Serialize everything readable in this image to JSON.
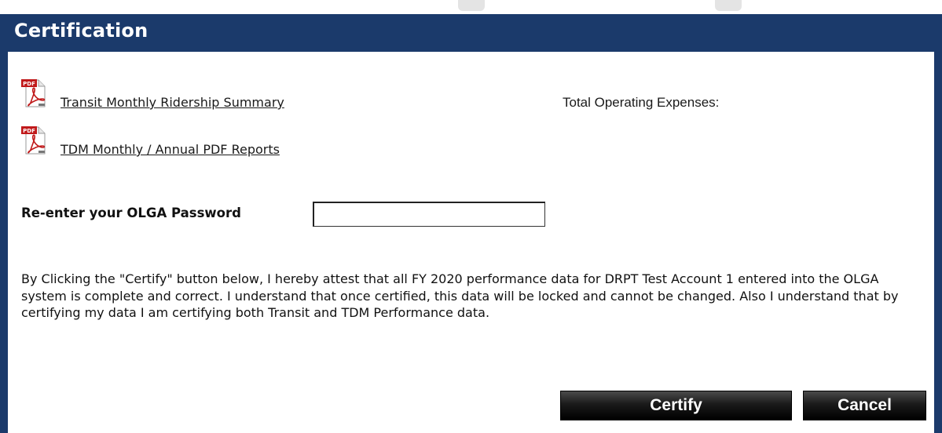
{
  "panel": {
    "title": "Certification",
    "header_color": "#1b3a6b"
  },
  "links": [
    {
      "label": "Transit Monthly Ridership Summary",
      "icon": "pdf-icon"
    },
    {
      "label": "TDM Monthly / Annual PDF Reports",
      "icon": "pdf-icon"
    }
  ],
  "summary": {
    "total_operating_expenses_label": "Total Operating Expenses:"
  },
  "password": {
    "label": "Re-enter your OLGA Password",
    "value": "",
    "placeholder": ""
  },
  "attestation": "By Clicking the \"Certify\" button below, I hereby attest that all FY 2020 performance data for DRPT Test Account 1 entered into the OLGA system is complete and correct. I understand that once certified, this data will be locked and cannot be changed. Also I understand that by certifying my data I am certifying both Transit and TDM Performance data.",
  "buttons": {
    "certify": "Certify",
    "cancel": "Cancel"
  }
}
